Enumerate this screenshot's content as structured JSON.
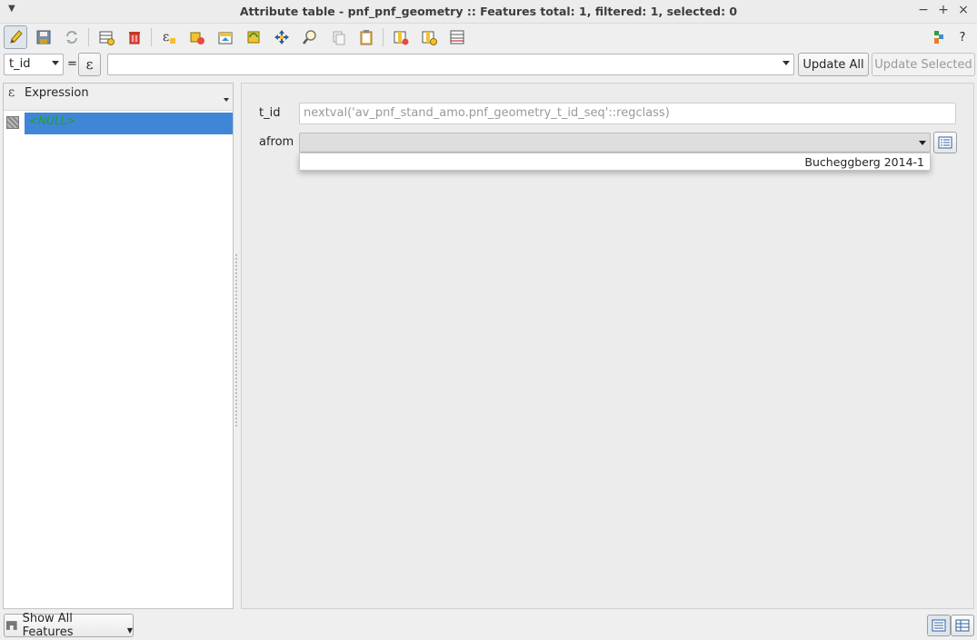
{
  "window": {
    "title": "Attribute table - pnf_pnf_geometry :: Features total: 1, filtered: 1, selected: 0",
    "minimize": "−",
    "maximize": "+",
    "close": "×"
  },
  "toolbar": {
    "icons": [
      "pencil-icon",
      "save-edits-icon",
      "reload-icon",
      "add-feature-icon",
      "delete-feature-icon",
      "select-by-expression-icon",
      "deselect-icon",
      "move-selection-top-icon",
      "invert-selection-icon",
      "pan-to-selected-icon",
      "zoom-to-selected-icon",
      "copy-icon",
      "paste-icon",
      "delete-field-icon",
      "new-field-icon",
      "field-calculator-icon",
      "conditional-formatting-icon",
      "help-icon"
    ],
    "help": "?"
  },
  "filterbar": {
    "field": "t_id",
    "equals": "=",
    "expression_symbol": "ε",
    "value": "",
    "update_all": "Update All",
    "update_selected": "Update Selected"
  },
  "leftpane": {
    "header_label": "Expression",
    "header_icon": "ε",
    "rows": [
      {
        "value": "<NULL>"
      }
    ]
  },
  "form": {
    "fields": [
      {
        "label": "t_id",
        "value": "nextval('av_pnf_stand_amo.pnf_geometry_t_id_seq'::regclass)"
      },
      {
        "label": "afrom",
        "value": ""
      }
    ],
    "dropdown_option": "Bucheggberg 2014-1"
  },
  "bottombar": {
    "show_all": "Show All Features"
  },
  "colors": {
    "selection": "#3f87d6",
    "null_text": "#1fa11f"
  }
}
